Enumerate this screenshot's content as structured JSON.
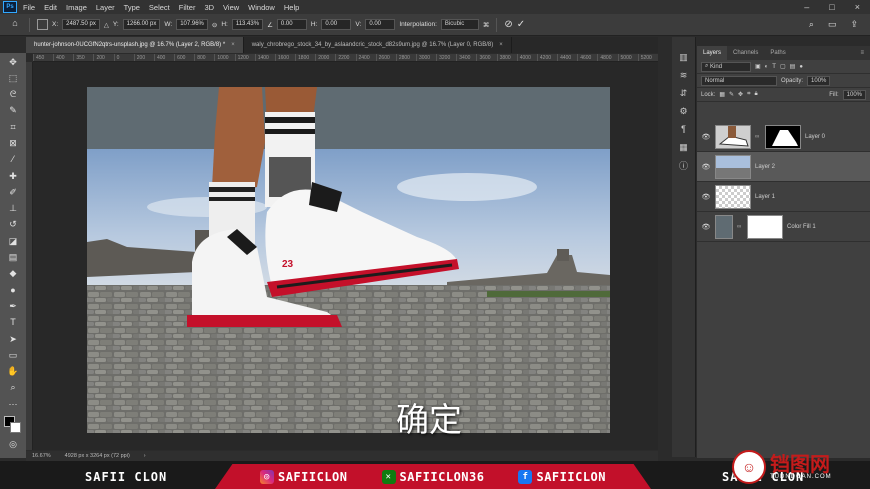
{
  "app": {
    "logo": "Ps",
    "menu": [
      "File",
      "Edit",
      "Image",
      "Layer",
      "Type",
      "Select",
      "Filter",
      "3D",
      "View",
      "Window",
      "Help"
    ]
  },
  "options": {
    "x_label": "X:",
    "x_value": "2487.50 px",
    "y_label": "Y:",
    "y_value": "1266.00 px",
    "w_label": "W:",
    "w_value": "107.96%",
    "h_label": "H:",
    "h_value": "113.43%",
    "angle_value": "0.00",
    "hskew_label": "H:",
    "hskew_value": "0.00",
    "vskew_label": "V:",
    "vskew_value": "0.00",
    "interp_label": "Interpolation:",
    "interp_value": "Bicubic"
  },
  "tabs": [
    {
      "label": "hunter-johnson-0UCGfN2qtrs-unsplash.jpg @ 16.7% (Layer 2, RGB/8) *",
      "close": "×"
    },
    {
      "label": "waly_chrobrego_stock_34_by_aslaandcric_stock_d82s9um.jpg @ 16.7% (Layer 0, RGB/8)",
      "close": "×"
    }
  ],
  "ruler": [
    "450",
    "400",
    "350",
    "200",
    "0",
    "200",
    "400",
    "600",
    "800",
    "1000",
    "1200",
    "1400",
    "1600",
    "1800",
    "2000",
    "2200",
    "2400",
    "2600",
    "2800",
    "3000",
    "3200",
    "3400",
    "3600",
    "3800",
    "4000",
    "4200",
    "4400",
    "4600",
    "4800",
    "5000",
    "5200"
  ],
  "status": {
    "zoom": "16.67%",
    "doc": "4928 px x 3264 px (72 ppi)"
  },
  "panel": {
    "tabs": [
      "Layers",
      "Channels",
      "Paths"
    ],
    "kind": "Kind",
    "blend": "Normal",
    "opacity_label": "Opacity:",
    "opacity_value": "100%",
    "lock_label": "Lock:",
    "fill_label": "Fill:",
    "fill_value": "100%",
    "layers": [
      {
        "name": "Layer 0",
        "selected": false
      },
      {
        "name": "Layer 2",
        "selected": true
      },
      {
        "name": "Layer 1",
        "selected": false
      },
      {
        "name": "Color Fill 1",
        "selected": false
      }
    ]
  },
  "subtitle": "确定",
  "footer": {
    "left": "SAFII CLON",
    "instagram": "SAFIICLON",
    "xbox": "SAFIICLON36",
    "facebook": "SAFIICLON",
    "right": "SAFII CLON"
  },
  "watermark": {
    "cn": "铛图网",
    "url": "TUDNDOAN.COM"
  },
  "colors": {
    "ps_blue": "#31a8ff",
    "banner_red": "#c2102a",
    "sky": "#9fb6d6",
    "ground": "#7a7a76"
  }
}
